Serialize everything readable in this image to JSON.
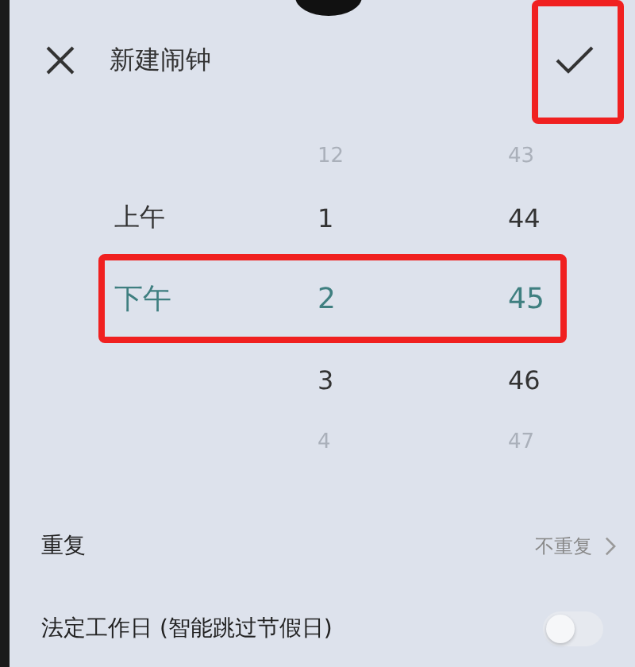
{
  "header": {
    "title": "新建闹钟"
  },
  "picker": {
    "rows": [
      {
        "hour": "12",
        "minute": "43",
        "selected": false
      },
      {
        "period": "上午",
        "hour": "1",
        "minute": "44",
        "selected": false
      },
      {
        "period": "下午",
        "hour": "2",
        "minute": "45",
        "selected": true
      },
      {
        "hour": "3",
        "minute": "46",
        "selected": false
      },
      {
        "hour": "4",
        "minute": "47",
        "selected": false
      }
    ]
  },
  "settings": [
    {
      "kind": "link",
      "label": "重复",
      "value": "不重复"
    },
    {
      "kind": "toggle",
      "label": "法定工作日 (智能跳过节假日)",
      "on": false
    }
  ]
}
